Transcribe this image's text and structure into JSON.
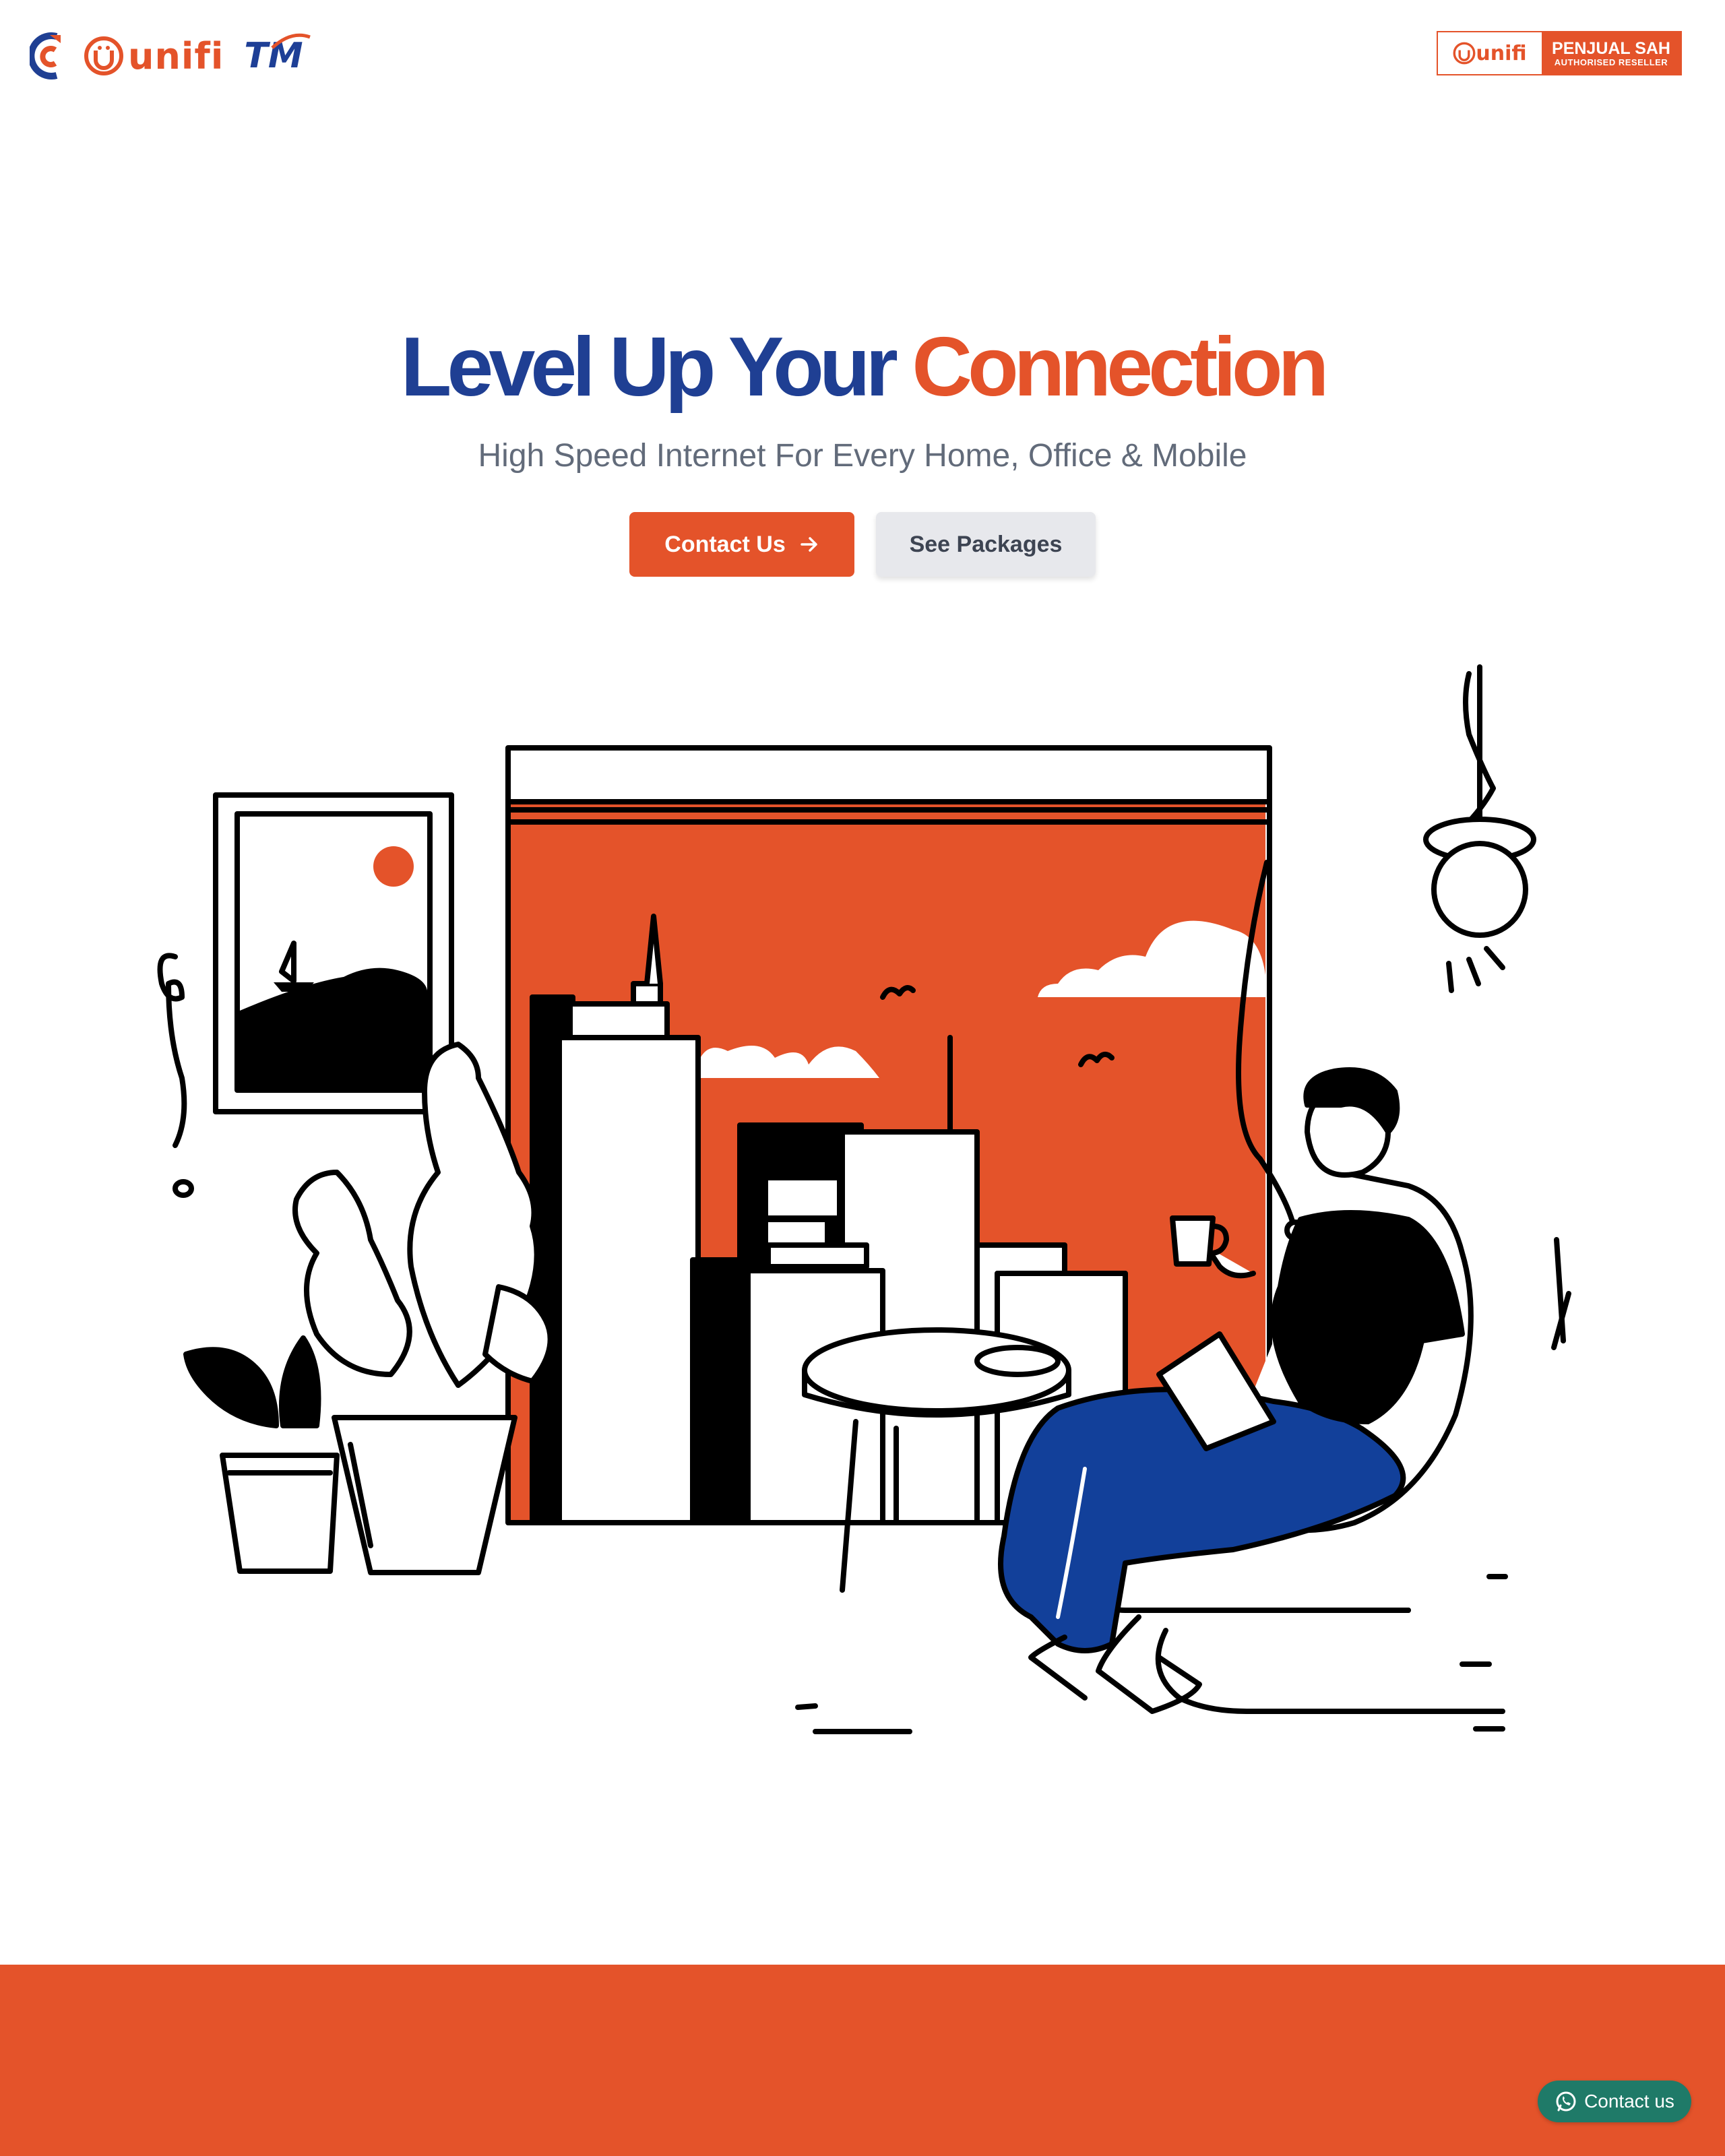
{
  "header": {
    "logos": {
      "unifi_text": "unifi",
      "tm_text": "TM"
    },
    "badge": {
      "logo_text": "unifi",
      "line1": "PENJUAL SAH",
      "line2": "AUTHORISED RESELLER"
    }
  },
  "hero": {
    "title_part1": "Level Up Your",
    "title_part2": "Connection",
    "subtitle": "High Speed Internet For Every Home, Office & Mobile",
    "contact_label": "Contact Us",
    "packages_label": "See Packages"
  },
  "floating": {
    "whatsapp_label": "Contact us"
  },
  "colors": {
    "brand_orange": "#e4532a",
    "brand_blue": "#1f3f93",
    "whatsapp_green": "#1f7a68",
    "pants_blue": "#12409a"
  },
  "icons": {
    "contact_arrow": "arrow-right-icon",
    "whatsapp": "whatsapp-icon"
  }
}
